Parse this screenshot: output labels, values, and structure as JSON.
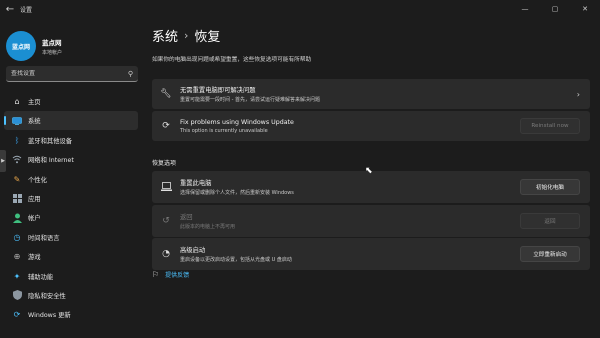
{
  "window": {
    "title": "设置",
    "back_icon": "back-arrow-icon",
    "minimize": "—",
    "maximize": "▢",
    "close": "✕"
  },
  "profile": {
    "avatar_text": "蓝点网",
    "name": "蓝点网",
    "account_type": "本地帐户"
  },
  "search": {
    "placeholder": "查找设置"
  },
  "sidebar": {
    "items": [
      {
        "label": "主页",
        "icon": "home-icon"
      },
      {
        "label": "系统",
        "icon": "system-icon",
        "active": true
      },
      {
        "label": "蓝牙和其他设备",
        "icon": "bluetooth-icon"
      },
      {
        "label": "网络和 Internet",
        "icon": "wifi-icon"
      },
      {
        "label": "个性化",
        "icon": "brush-icon"
      },
      {
        "label": "应用",
        "icon": "apps-icon"
      },
      {
        "label": "帐户",
        "icon": "account-icon"
      },
      {
        "label": "时间和语言",
        "icon": "clock-globe-icon"
      },
      {
        "label": "游戏",
        "icon": "gamepad-icon"
      },
      {
        "label": "辅助功能",
        "icon": "accessibility-icon"
      },
      {
        "label": "隐私和安全性",
        "icon": "shield-icon"
      },
      {
        "label": "Windows 更新",
        "icon": "update-icon"
      }
    ],
    "accent_color": "#4cc2ff"
  },
  "main": {
    "breadcrumb_parent": "系统",
    "breadcrumb_sep": "›",
    "breadcrumb_current": "恢复",
    "description": "如果你的电脑出现问题或希望重置，这些恢复选项可能有所帮助",
    "cards": {
      "fix_without_reset": {
        "title": "无需重置电脑即可解决问题",
        "subtitle": "重置可能需要一段时间 - 首先，请尝试运行疑难解答来解决问题"
      },
      "fix_windows_update": {
        "title": "Fix problems using Windows Update",
        "subtitle": "This option is currently unavailable",
        "button": "Reinstall now"
      }
    },
    "section_title": "恢复选项",
    "recovery": {
      "reset": {
        "title": "重置此电脑",
        "subtitle": "选择保留或删除个人文件，然后重新安装 Windows",
        "button": "初始化电脑"
      },
      "go_back": {
        "title": "返回",
        "subtitle": "此版本的电脑上不再可用",
        "button": "返回"
      },
      "advanced": {
        "title": "高级启动",
        "subtitle": "重启设备以更改启动设置，包括从光盘或 U 盘启动",
        "button": "立即重新启动"
      }
    },
    "feedback": "提供反馈"
  }
}
